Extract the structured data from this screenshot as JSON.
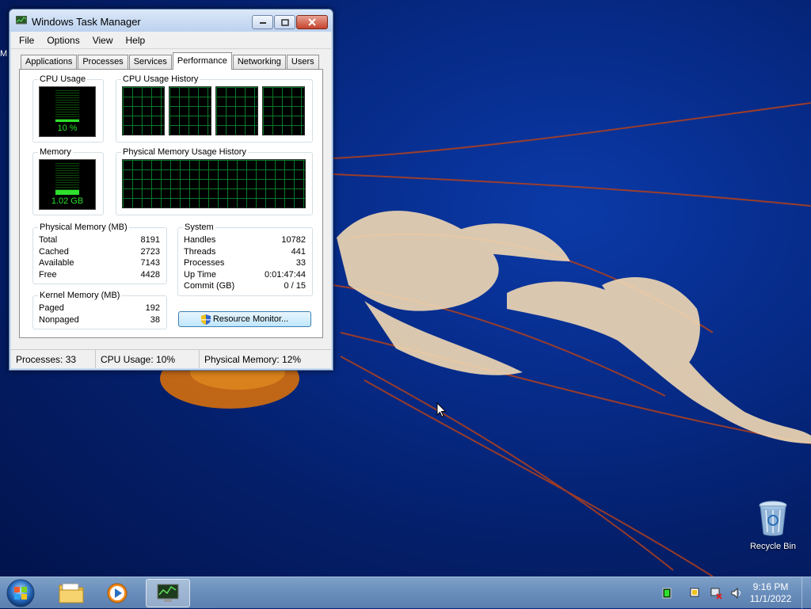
{
  "desktop": {
    "edge_letter": "M",
    "recycle_bin_label": "Recycle Bin"
  },
  "window": {
    "title": "Windows Task Manager",
    "menu": [
      "File",
      "Options",
      "View",
      "Help"
    ],
    "tabs": [
      "Applications",
      "Processes",
      "Services",
      "Performance",
      "Networking",
      "Users"
    ],
    "active_tab": "Performance"
  },
  "performance": {
    "cpu_usage": {
      "label": "CPU Usage",
      "value": "10 %",
      "percent": 10
    },
    "cpu_history_label": "CPU Usage History",
    "memory": {
      "label": "Memory",
      "value": "1.02 GB",
      "percent": 12
    },
    "memory_history_label": "Physical Memory Usage History",
    "physical_memory": {
      "label": "Physical Memory (MB)",
      "rows": [
        {
          "name": "Total",
          "value": "8191"
        },
        {
          "name": "Cached",
          "value": "2723"
        },
        {
          "name": "Available",
          "value": "7143"
        },
        {
          "name": "Free",
          "value": "4428"
        }
      ]
    },
    "kernel_memory": {
      "label": "Kernel Memory (MB)",
      "rows": [
        {
          "name": "Paged",
          "value": "192"
        },
        {
          "name": "Nonpaged",
          "value": "38"
        }
      ]
    },
    "system": {
      "label": "System",
      "rows": [
        {
          "name": "Handles",
          "value": "10782"
        },
        {
          "name": "Threads",
          "value": "441"
        },
        {
          "name": "Processes",
          "value": "33"
        },
        {
          "name": "Up Time",
          "value": "0:01:47:44"
        },
        {
          "name": "Commit (GB)",
          "value": "0 / 15"
        }
      ]
    },
    "resource_monitor_button": "Resource Monitor..."
  },
  "statusbar": {
    "processes": "Processes: 33",
    "cpu": "CPU Usage: 10%",
    "memory": "Physical Memory: 12%"
  },
  "taskbar": {
    "time": "9:16 PM",
    "date": "11/1/2022"
  },
  "colors": {
    "graph_line": "#2ee02e",
    "graph_grid": "#0a7a2a",
    "window_frame": "#c9daf0",
    "taskbar": "#6b8fbd"
  }
}
